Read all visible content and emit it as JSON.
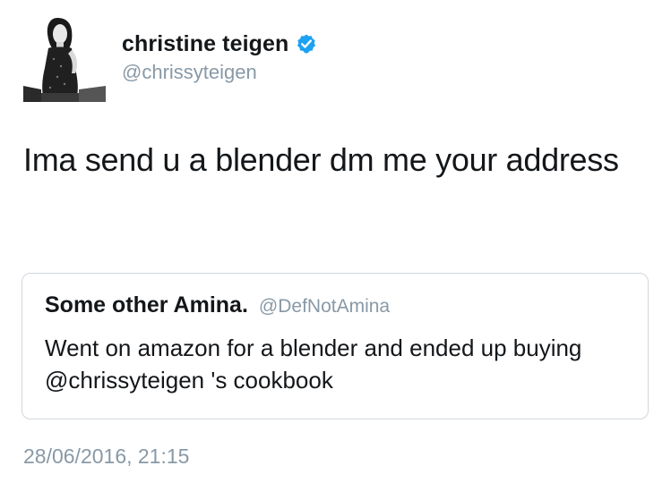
{
  "author": {
    "display_name": "christine teigen",
    "handle": "@chrissyteigen",
    "verified": true,
    "avatar_icon": "profile-photo"
  },
  "tweet": {
    "text": "Ima send u a blender dm me your address",
    "timestamp": "28/06/2016, 21:15"
  },
  "quoted_tweet": {
    "display_name": "Some other Amina.",
    "handle": "@DefNotAmina",
    "text": "Went on amazon for a blender and ended up buying @chrissyteigen 's cookbook"
  },
  "colors": {
    "text": "#14171a",
    "secondary": "#8899a6",
    "verified_badge": "#1da1f2",
    "quote_border": "#d0d7de"
  }
}
